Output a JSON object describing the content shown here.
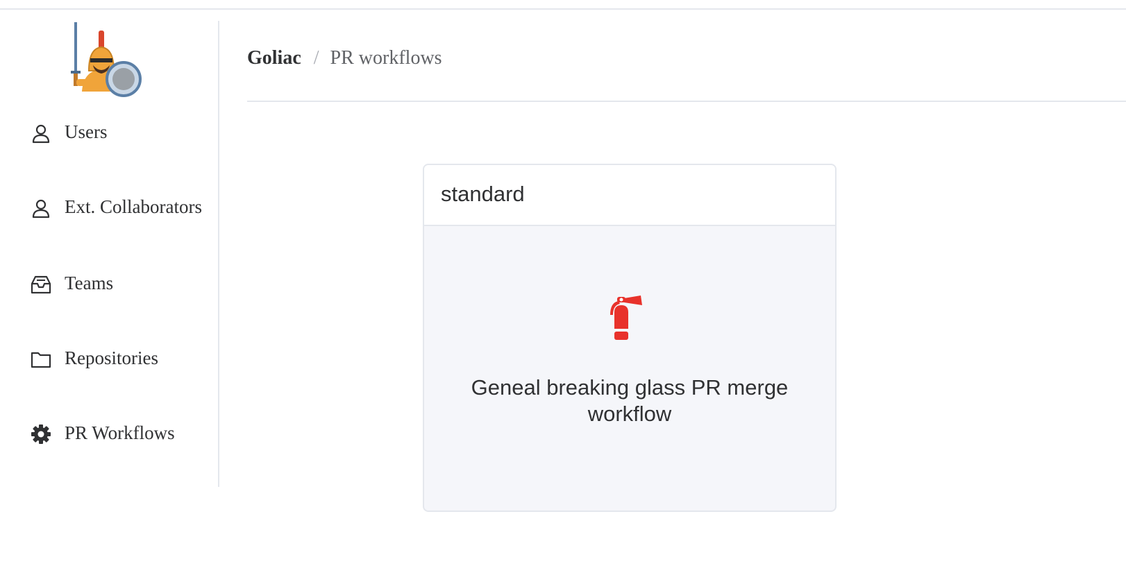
{
  "sidebar": {
    "items": [
      {
        "label": "Users",
        "icon": "user-icon"
      },
      {
        "label": "Ext. Collaborators",
        "icon": "user-icon"
      },
      {
        "label": "Teams",
        "icon": "inbox-icon"
      },
      {
        "label": "Repositories",
        "icon": "folder-icon"
      },
      {
        "label": "PR Workflows",
        "icon": "gear-icon",
        "active": true
      }
    ]
  },
  "breadcrumb": {
    "root": "Goliac",
    "separator": "/",
    "current": "PR workflows"
  },
  "workflows": [
    {
      "name": "standard",
      "icon": "fire-extinguisher-icon",
      "icon_color": "#e8322b",
      "description": "Geneal breaking glass PR merge workflow"
    }
  ],
  "colors": {
    "accent_red": "#e8322b",
    "card_body_bg": "#f5f6fa",
    "border": "#e4e7ed",
    "text": "#303133"
  }
}
